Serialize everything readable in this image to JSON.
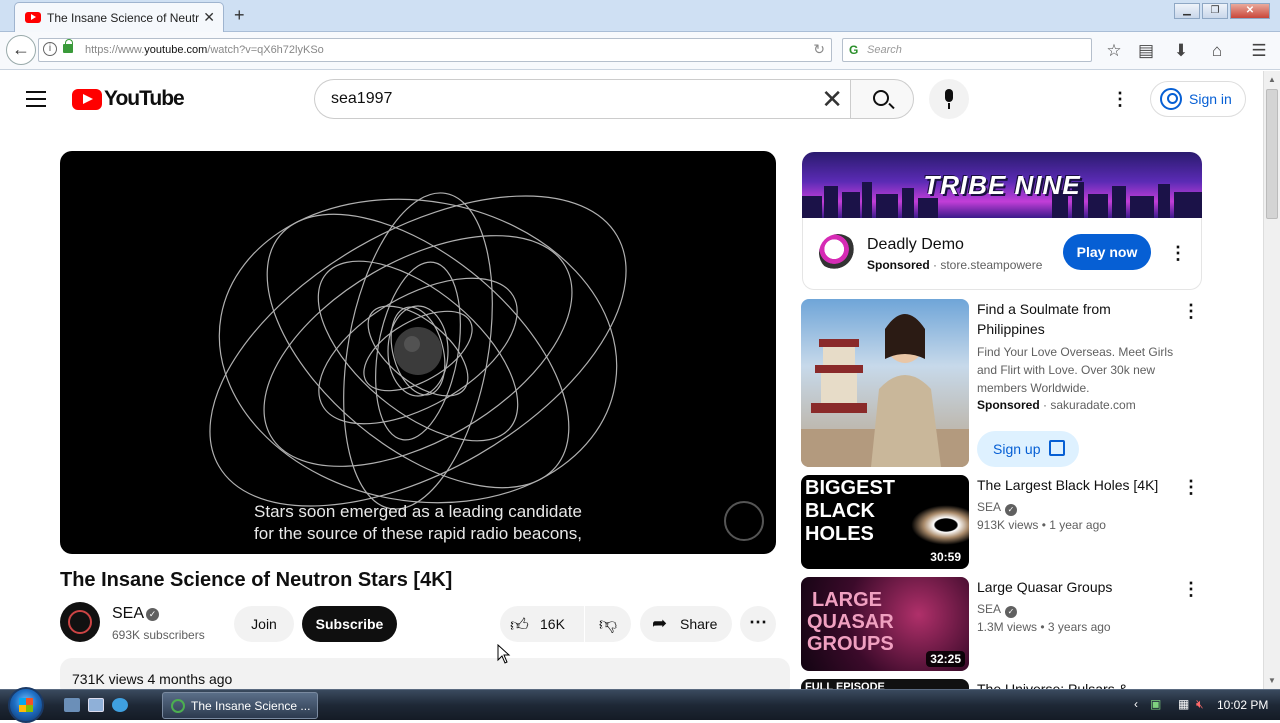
{
  "browser": {
    "tab_title": "The Insane Science of Neutr",
    "url_host": "https://www.",
    "url_domain": "youtube.com",
    "url_path": "/watch?v=qX6h72lyKSo",
    "search_placeholder": "Search",
    "new_tab": "+",
    "close_tab": "✕"
  },
  "youtube": {
    "logo_text": "YouTube",
    "search_query": "sea1997",
    "sign_in": "Sign in"
  },
  "video": {
    "caption_line1": "Stars soon emerged as a leading candidate",
    "caption_line2": "for the source of these rapid radio beacons,",
    "title": "The Insane Science of Neutron Stars [4K]",
    "channel": "SEA",
    "subscribers": "693K subscribers",
    "join": "Join",
    "subscribe": "Subscribe",
    "likes": "16K",
    "share": "Share",
    "views_date": "731K views  4 months ago"
  },
  "ad": {
    "banner_text": "TRIBE NINE",
    "title": "Deadly Demo",
    "sponsored": "Sponsored",
    "source": "· store.steampowere",
    "cta": "Play now"
  },
  "related": [
    {
      "title_line1": "Find a Soulmate from",
      "title_line2": "Philippines",
      "desc": "Find Your Love Overseas. Meet Girls and Flirt with Love. Over 30k new members Worldwide.",
      "sponsored": "Sponsored",
      "source": "· sakuradate.com",
      "cta": "Sign up"
    },
    {
      "title": "The Largest Black Holes [4K]",
      "channel": "SEA",
      "meta": "913K views  • 1 year ago",
      "duration": "30:59",
      "thumb_text": "BIGGEST BLACK HOLES"
    },
    {
      "title": "Large Quasar Groups",
      "channel": "SEA",
      "meta": "1.3M views  • 3 years ago",
      "duration": "32:25",
      "thumb_text": "LARGE QUASAR GROUPS"
    },
    {
      "title": "The Universe: Pulsars &",
      "thumb_text": "FULL EPISODE"
    }
  ],
  "taskbar": {
    "task_label": "The Insane Science ...",
    "clock": "10:02 PM"
  }
}
